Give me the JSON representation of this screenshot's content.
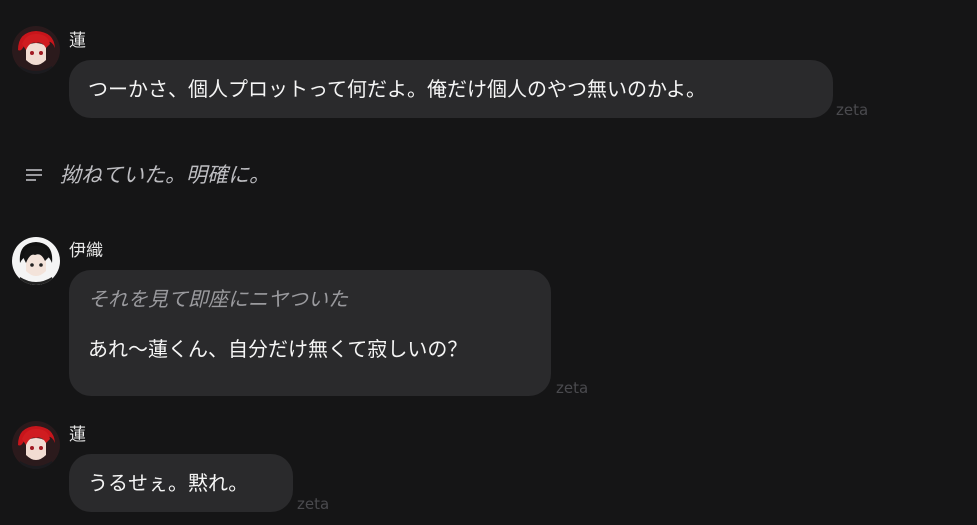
{
  "messages": [
    {
      "speaker": "蓮",
      "text": "つーかさ、個人プロットって何だよ。俺だけ個人のやつ無いのかよ。",
      "badge": "zeta"
    },
    {
      "narration": "拗ねていた。明確に。"
    },
    {
      "speaker": "伊織",
      "action": "それを見て即座にニヤついた",
      "text": "あれ〜蓮くん、自分だけ無くて寂しいの？",
      "badge": "zeta"
    },
    {
      "speaker": "蓮",
      "text": "うるせぇ。黙れ。",
      "badge": "zeta"
    }
  ],
  "colors": {
    "background": "#151516",
    "bubble": "#2a2a2c",
    "ren_hair": "#c8151b",
    "iori_hair": "#111111"
  },
  "icons": {
    "narration": "lines-icon",
    "avatar_ren": "avatar-ren",
    "avatar_iori": "avatar-iori"
  }
}
